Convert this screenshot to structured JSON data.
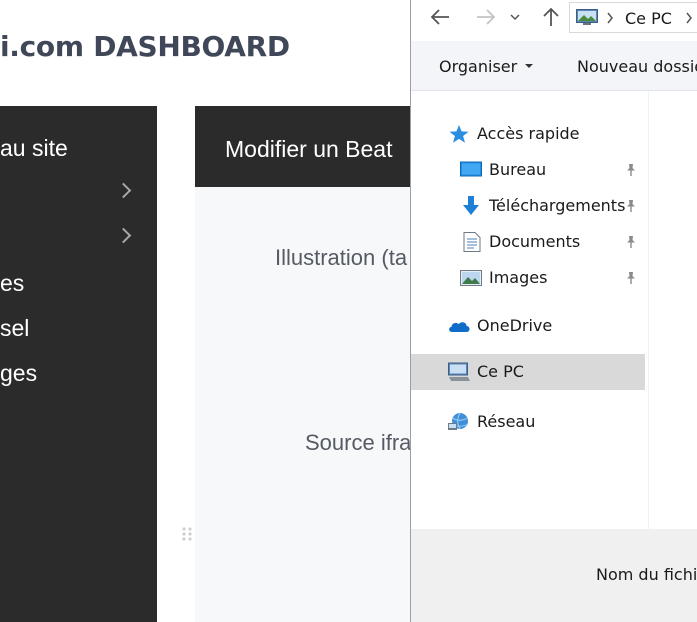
{
  "dashboard": {
    "title": "i.com DASHBOARD",
    "sidebar": {
      "items": [
        {
          "label": "au site",
          "chevron": false
        },
        {
          "label": "",
          "chevron": true
        },
        {
          "label": "",
          "chevron": true
        },
        {
          "label": "es",
          "chevron": false
        },
        {
          "label": "sel",
          "chevron": false
        },
        {
          "label": "ges",
          "chevron": false
        }
      ]
    },
    "panel": {
      "title": "Modifier un Beat",
      "illustration_label": "Illustration (ta",
      "source_label": "Source ifra"
    }
  },
  "explorer": {
    "address": {
      "current": "Ce PC"
    },
    "toolbar": {
      "organize_label": "Organiser",
      "new_folder_label": "Nouveau dossie"
    },
    "nav": {
      "quick_access": {
        "label": "Accès rapide",
        "icon": "star-icon",
        "color": "#2b8de0"
      },
      "items": [
        {
          "label": "Bureau",
          "icon": "desktop-icon",
          "pinned": true
        },
        {
          "label": "Téléchargements",
          "icon": "download-icon",
          "pinned": true
        },
        {
          "label": "Documents",
          "icon": "document-icon",
          "pinned": true
        },
        {
          "label": "Images",
          "icon": "images-icon",
          "pinned": true
        }
      ],
      "onedrive": {
        "label": "OneDrive",
        "icon": "cloud-icon",
        "color": "#0f6cc8"
      },
      "this_pc": {
        "label": "Ce PC",
        "icon": "computer-icon",
        "selected": true
      },
      "network": {
        "label": "Réseau",
        "icon": "network-icon"
      }
    },
    "footer": {
      "filename_label": "Nom du fichi"
    }
  }
}
